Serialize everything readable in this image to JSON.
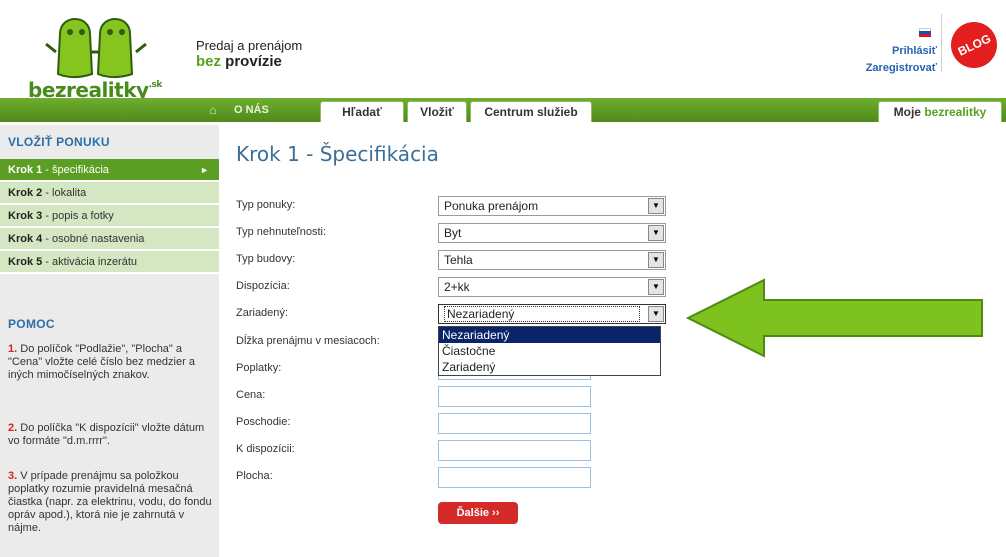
{
  "header": {
    "logo_text": "bezrealitky",
    "logo_suffix": ".sk",
    "tagline_line1": "Predaj a prenájom",
    "tagline_line2_accent": "bez",
    "tagline_line2_rest": " provízie",
    "login": "Prihlásiť",
    "register": "Zaregistrovať",
    "blog": "BLOG"
  },
  "nav": {
    "home_icon": "home-icon",
    "about": "O NÁS",
    "tabs": [
      "Hľadať",
      "Vložiť",
      "Centrum služieb"
    ],
    "my_prefix": "Moje ",
    "my_accent": "bezrealitky"
  },
  "sidebar": {
    "title": "VLOŽIŤ PONUKU",
    "steps": [
      {
        "num": "Krok 1",
        "label": " - špecifikácia",
        "active": true
      },
      {
        "num": "Krok 2",
        "label": " - lokalita"
      },
      {
        "num": "Krok 3",
        "label": " - popis a fotky"
      },
      {
        "num": "Krok 4",
        "label": " - osobné nastavenia"
      },
      {
        "num": "Krok 5",
        "label": " - aktivácia inzerátu"
      }
    ],
    "help_title": "POMOC",
    "help": [
      {
        "num": "1.",
        "text": " Do políčok \"Podlažie\", \"Plocha\" a \"Cena\" vložte celé číslo bez medzier a iných mimočíselných znakov."
      },
      {
        "num": "2.",
        "text": " Do políčka \"K dispozícii\" vložte dátum vo formáte \"d.m.rrrr\"."
      },
      {
        "num": "3.",
        "text": " V prípade prenájmu sa položkou poplatky rozumie pravidelná mesačná čiastka (napr. za elektrinu, vodu, do fondu opráv apod.), ktorá nie je zahrnutá v nájme."
      }
    ]
  },
  "main": {
    "title": "Krok 1 - Špecifikácia",
    "fields": {
      "offer_type": {
        "label": "Typ ponuky:",
        "value": "Ponuka prenájom"
      },
      "property_type": {
        "label": "Typ nehnuteľnosti:",
        "value": "Byt"
      },
      "building_type": {
        "label": "Typ budovy:",
        "value": "Tehla"
      },
      "layout": {
        "label": "Dispozícia:",
        "value": "2+kk"
      },
      "furnished": {
        "label": "Zariadený:",
        "value": "Nezariadený"
      },
      "lease_length": {
        "label": "Dĺžka prenájmu v mesiacoch:"
      },
      "fees": {
        "label": "Poplatky:"
      },
      "price": {
        "label": "Cena:"
      },
      "floor": {
        "label": "Poschodie:"
      },
      "available": {
        "label": "K dispozícii:"
      },
      "area": {
        "label": "Plocha:"
      }
    },
    "furnished_options": [
      "Nezariadený",
      "Čiastočne",
      "Zariadený"
    ],
    "next_button": "Ďalšie ››"
  },
  "colors": {
    "brand_green": "#58a21c",
    "nav_green": "#5c9d24",
    "link_blue": "#2862b3",
    "title_blue": "#3b6f98",
    "accent_red": "#d42a2a",
    "arrow_green": "#7dc21e"
  }
}
